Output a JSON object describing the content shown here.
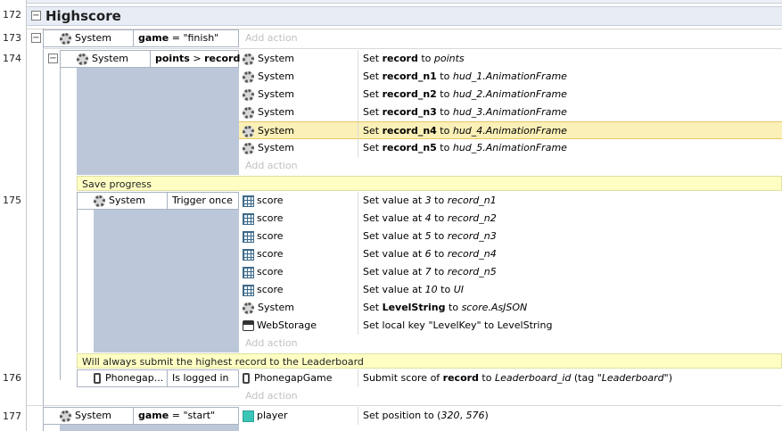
{
  "group": {
    "line": "172",
    "title": "Highscore"
  },
  "add_action_label": "Add action",
  "event173": {
    "line": "173",
    "object": "System",
    "condition_parts": [
      "game",
      " = \"finish\""
    ]
  },
  "event174": {
    "line": "174",
    "object": "System",
    "condition_parts": [
      "points",
      " > ",
      "record"
    ],
    "actions": [
      {
        "object": "System",
        "icon": "gear-icon",
        "parts": [
          [
            "Set ",
            ""
          ],
          [
            "record",
            "b"
          ],
          [
            " to ",
            ""
          ],
          [
            "points",
            "i"
          ]
        ],
        "highlighted": false
      },
      {
        "object": "System",
        "icon": "gear-icon",
        "parts": [
          [
            "Set ",
            ""
          ],
          [
            "record_n1",
            "b"
          ],
          [
            " to ",
            ""
          ],
          [
            "hud_1.AnimationFrame",
            "i"
          ]
        ],
        "highlighted": false
      },
      {
        "object": "System",
        "icon": "gear-icon",
        "parts": [
          [
            "Set ",
            ""
          ],
          [
            "record_n2",
            "b"
          ],
          [
            " to ",
            ""
          ],
          [
            "hud_2.AnimationFrame",
            "i"
          ]
        ],
        "highlighted": false
      },
      {
        "object": "System",
        "icon": "gear-icon",
        "parts": [
          [
            "Set ",
            ""
          ],
          [
            "record_n3",
            "b"
          ],
          [
            " to ",
            ""
          ],
          [
            "hud_3.AnimationFrame",
            "i"
          ]
        ],
        "highlighted": false
      },
      {
        "object": "System",
        "icon": "gear-icon",
        "parts": [
          [
            "Set ",
            ""
          ],
          [
            "record_n4",
            "b"
          ],
          [
            " to ",
            ""
          ],
          [
            "hud_4.AnimationFrame",
            "i"
          ]
        ],
        "highlighted": true
      },
      {
        "object": "System",
        "icon": "gear-icon",
        "parts": [
          [
            "Set ",
            ""
          ],
          [
            "record_n5",
            "b"
          ],
          [
            " to ",
            ""
          ],
          [
            "hud_5.AnimationFrame",
            "i"
          ]
        ],
        "highlighted": false
      }
    ]
  },
  "comment1": "Save progress",
  "event175": {
    "line": "175",
    "object": "System",
    "condition": "Trigger once",
    "actions": [
      {
        "object": "score",
        "icon": "array-icon",
        "parts": [
          [
            "Set value at ",
            ""
          ],
          [
            "3",
            "i"
          ],
          [
            " to ",
            ""
          ],
          [
            "record_n1",
            "i"
          ]
        ]
      },
      {
        "object": "score",
        "icon": "array-icon",
        "parts": [
          [
            "Set value at ",
            ""
          ],
          [
            "4",
            "i"
          ],
          [
            " to ",
            ""
          ],
          [
            "record_n2",
            "i"
          ]
        ]
      },
      {
        "object": "score",
        "icon": "array-icon",
        "parts": [
          [
            "Set value at ",
            ""
          ],
          [
            "5",
            "i"
          ],
          [
            " to ",
            ""
          ],
          [
            "record_n3",
            "i"
          ]
        ]
      },
      {
        "object": "score",
        "icon": "array-icon",
        "parts": [
          [
            "Set value at ",
            ""
          ],
          [
            "6",
            "i"
          ],
          [
            " to ",
            ""
          ],
          [
            "record_n4",
            "i"
          ]
        ]
      },
      {
        "object": "score",
        "icon": "array-icon",
        "parts": [
          [
            "Set value at ",
            ""
          ],
          [
            "7",
            "i"
          ],
          [
            " to ",
            ""
          ],
          [
            "record_n5",
            "i"
          ]
        ]
      },
      {
        "object": "score",
        "icon": "array-icon",
        "parts": [
          [
            "Set value at ",
            ""
          ],
          [
            "10",
            "i"
          ],
          [
            " to ",
            ""
          ],
          [
            "UI",
            "i"
          ]
        ]
      },
      {
        "object": "System",
        "icon": "gear-icon",
        "parts": [
          [
            "Set ",
            ""
          ],
          [
            "LevelString",
            "b"
          ],
          [
            " to ",
            ""
          ],
          [
            "score.AsJSON",
            "i"
          ]
        ]
      },
      {
        "object": "WebStorage",
        "icon": "webstorage-icon",
        "parts": [
          [
            "Set local key \"LevelKey\" to LevelString",
            ""
          ]
        ]
      }
    ]
  },
  "comment2": "Will always submit the highest record to the Leaderboard",
  "event176": {
    "line": "176",
    "object": "Phonegap...",
    "condition": "Is logged in",
    "actions": [
      {
        "object": "PhonegapGame",
        "icon": "phone-icon",
        "parts": [
          [
            "Submit score of ",
            ""
          ],
          [
            "record",
            "b"
          ],
          [
            " to ",
            ""
          ],
          [
            "Leaderboard_id",
            "i"
          ],
          [
            " (tag ",
            ""
          ],
          [
            "\"Leaderboard\"",
            "i"
          ],
          [
            ")",
            ""
          ]
        ]
      }
    ]
  },
  "event177": {
    "line": "177",
    "object": "System",
    "condition_parts": [
      "game",
      " = \"start\""
    ],
    "actions": [
      {
        "object": "player",
        "icon": "sprite-icon",
        "parts": [
          [
            "Set position to (",
            ""
          ],
          [
            "320",
            "i"
          ],
          [
            ", ",
            ""
          ],
          [
            "576",
            "i"
          ],
          [
            ")",
            ""
          ]
        ]
      }
    ]
  },
  "colors": {
    "highlight": "#fbf0b8",
    "comment": "#ffffc4",
    "condition_bar": "#bcc8d9",
    "group_header": "#e8edf5"
  }
}
